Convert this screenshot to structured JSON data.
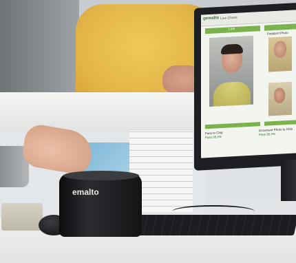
{
  "scene": {
    "brand_text": "emalto",
    "screen": {
      "header_left": "gemalto",
      "header_right": "Live Check",
      "live_label": "Live",
      "right_panel_title": "Passport Photo",
      "left_caption": "Face to Chip",
      "left_score": "Pass 95.0%",
      "right_caption": "Document Photo to Chip",
      "right_score": "Pass 95.0%"
    }
  },
  "colors": {
    "sweater": "#e3b548",
    "screen_green": "#7bb24d",
    "monitor": "#1d1f22",
    "reader": "#121315",
    "desk": "#e9ebe8"
  }
}
